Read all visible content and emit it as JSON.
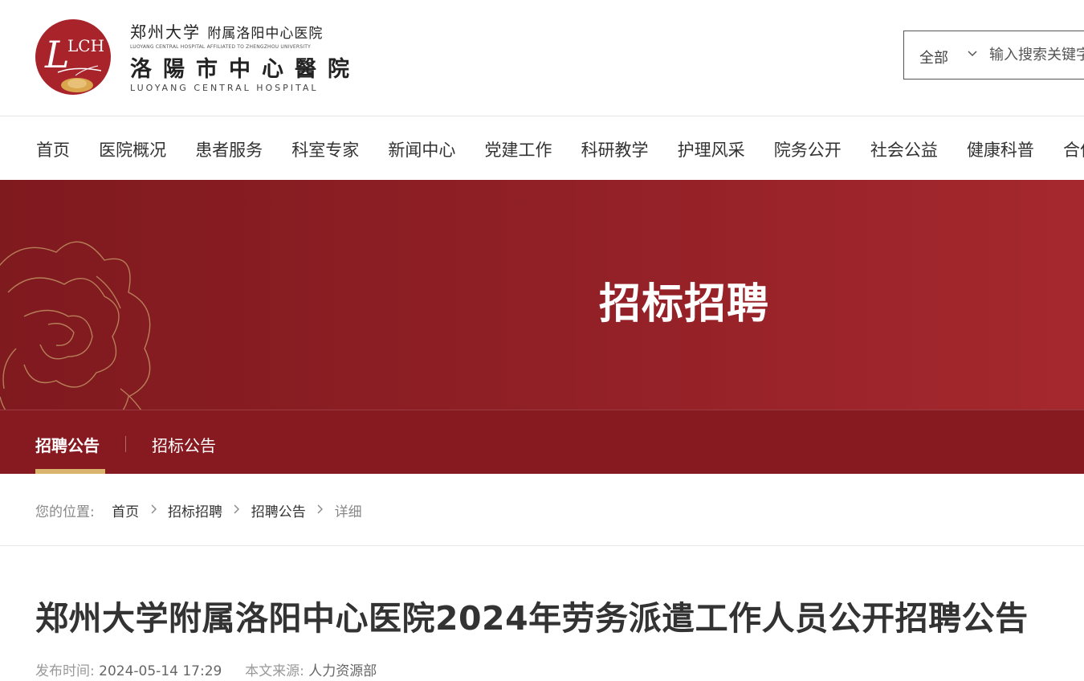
{
  "header": {
    "logo": {
      "mark": "LCH",
      "line1_university": "郑州大学",
      "line1_affiliation": "附属洛阳中心医院",
      "line2_english": "LUOYANG CENTRAL HOSPITAL AFFILIATED TO ZHENGZHOU UNIVERSITY",
      "line3_name": "洛陽市中心醫院",
      "line4_english": "LUOYANG CENTRAL HOSPITAL"
    },
    "search": {
      "scope": "全部",
      "placeholder": "输入搜索关键字"
    }
  },
  "nav": {
    "items": [
      "首页",
      "医院概况",
      "患者服务",
      "科室专家",
      "新闻中心",
      "党建工作",
      "科研教学",
      "护理风采",
      "院务公开",
      "社会公益",
      "健康科普",
      "合作交流"
    ]
  },
  "banner": {
    "title": "招标招聘",
    "tabs": [
      "招聘公告",
      "招标公告"
    ],
    "active_color": "#d9b46d",
    "brand_color": "#8e1f25"
  },
  "breadcrumb": {
    "label": "您的位置:",
    "items": [
      "首页",
      "招标招聘",
      "招聘公告"
    ],
    "current": "详细"
  },
  "article": {
    "title": "郑州大学附属洛阳中心医院2024年劳务派遣工作人员公开招聘公告",
    "publish_label": "发布时间:",
    "publish_time": "2024-05-14 17:29",
    "source_label": "本文来源:",
    "source": "人力资源部"
  }
}
